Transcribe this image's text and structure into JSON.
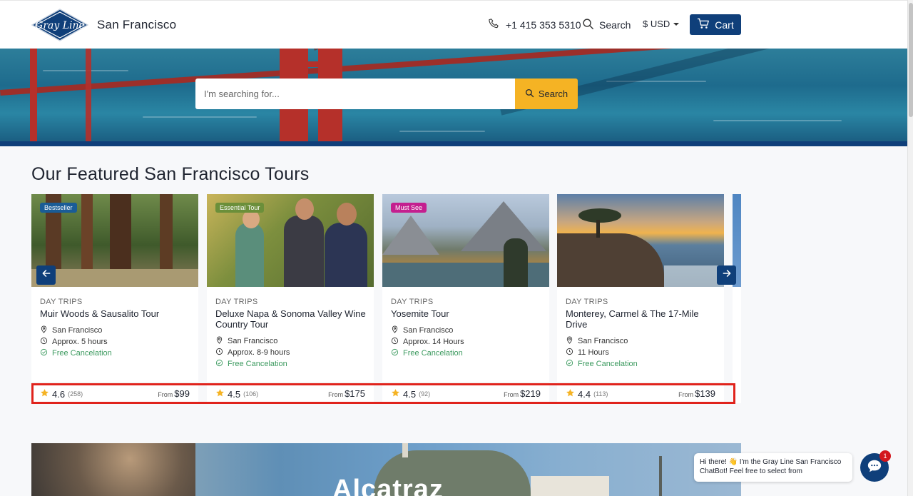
{
  "header": {
    "logo_text": "Gray Line",
    "city": "San Francisco",
    "phone": "+1 415 353 5310",
    "search_label": "Search",
    "currency": "$ USD",
    "cart_label": "Cart"
  },
  "hero": {
    "search_placeholder": "I'm searching for...",
    "search_button": "Search"
  },
  "section": {
    "title": "Our Featured San Francisco Tours"
  },
  "tours": [
    {
      "badge": "Bestseller",
      "badge_color": "#1a5c96",
      "category": "DAY TRIPS",
      "title": "Muir Woods & Sausalito Tour",
      "location": "San Francisco",
      "duration": "Approx. 5 hours",
      "cancel": "Free Cancelation",
      "rating": "4.6",
      "reviews": "(258)",
      "from": "From",
      "price": "$99"
    },
    {
      "badge": "Essential Tour",
      "badge_color": "#6b8f3a",
      "category": "DAY TRIPS",
      "title": "Deluxe Napa & Sonoma Valley Wine Country Tour",
      "location": "San Francisco",
      "duration": "Approx. 8-9 hours",
      "cancel": "Free Cancelation",
      "rating": "4.5",
      "reviews": "(106)",
      "from": "From",
      "price": "$175"
    },
    {
      "badge": "Must See",
      "badge_color": "#c41f8f",
      "category": "DAY TRIPS",
      "title": "Yosemite Tour",
      "location": "San Francisco",
      "duration": "Approx. 14 Hours",
      "cancel": "Free Cancelation",
      "rating": "4.5",
      "reviews": "(92)",
      "from": "From",
      "price": "$219"
    },
    {
      "badge": "",
      "badge_color": "",
      "category": "DAY TRIPS",
      "title": "Monterey, Carmel & The 17-Mile Drive",
      "location": "San Francisco",
      "duration": "11 Hours",
      "cancel": "Free Cancelation",
      "rating": "4.4",
      "reviews": "(113)",
      "from": "From",
      "price": "$139"
    }
  ],
  "banner": {
    "title": "Alcatraz"
  },
  "chat": {
    "message": "Hi there! 👋 I'm the Gray Line San Francisco ChatBot! Feel free to select from",
    "badge_count": "1"
  },
  "colors": {
    "brand_navy": "#0f3f7a",
    "accent_yellow": "#f5b324",
    "highlight_red": "#e0231c",
    "free_green": "#3c9a5f"
  }
}
